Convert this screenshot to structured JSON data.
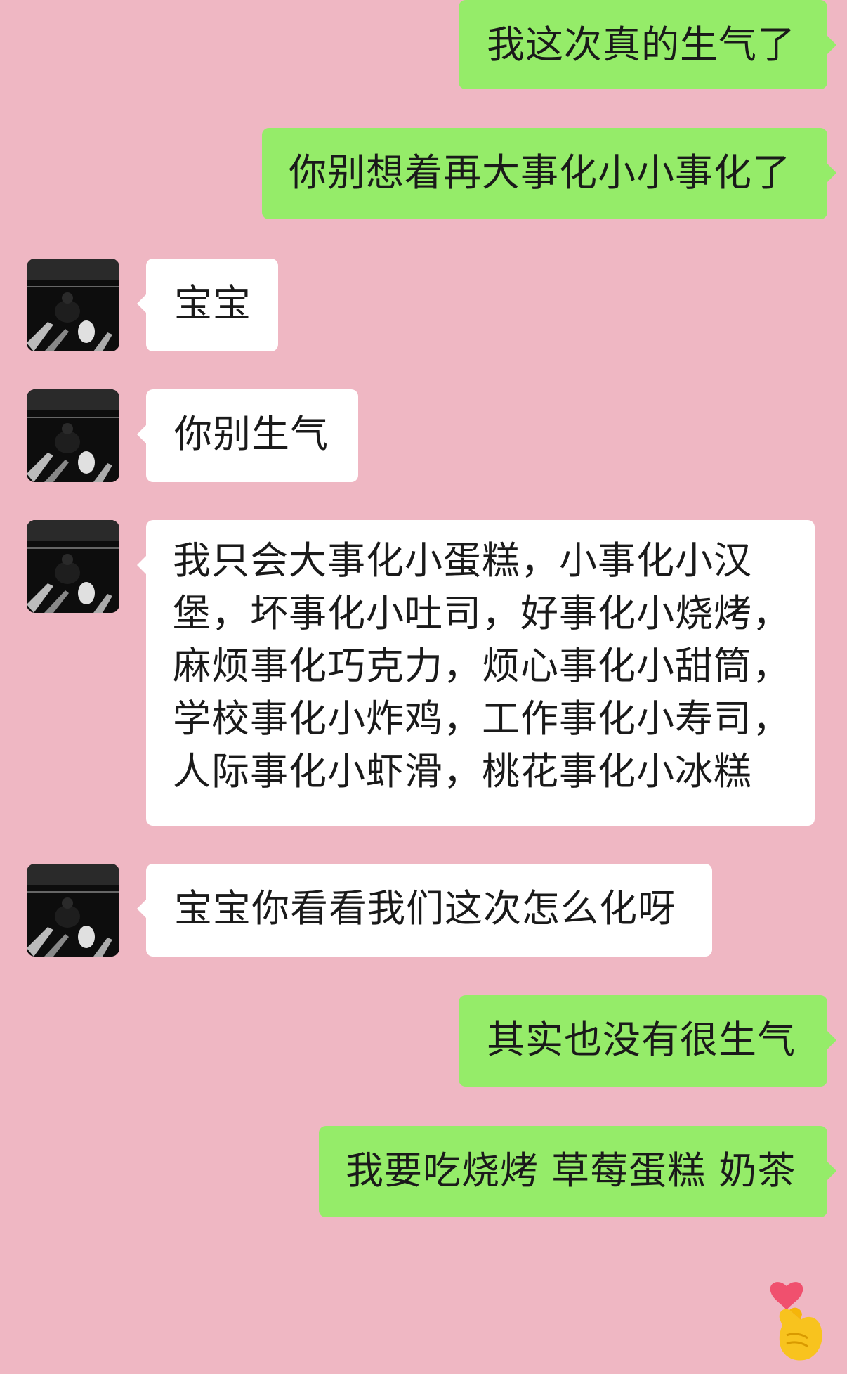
{
  "colors": {
    "background": "#efb7c3",
    "sent_bubble": "#95ec69",
    "received_bubble": "#ffffff",
    "text": "#1a1a1a"
  },
  "messages": [
    {
      "side": "right",
      "text": "我这次真的生气了"
    },
    {
      "side": "right",
      "text": "你别想着再大事化小小事化了"
    },
    {
      "side": "left",
      "text": "宝宝"
    },
    {
      "side": "left",
      "text": "你别生气"
    },
    {
      "side": "left",
      "lines": [
        "我只会大事化小蛋糕，小事化小汉",
        "堡，坏事化小吐司，好事化小烧烤，",
        "麻烦事化巧克力，烦心事化小甜筒，",
        "学校事化小炸鸡，工作事化小寿司，",
        "人际事化小虾滑，桃花事化小冰糕"
      ]
    },
    {
      "side": "left",
      "text": "宝宝你看看我们这次怎么化呀"
    },
    {
      "side": "right",
      "text": "其实也没有很生气"
    },
    {
      "side": "right",
      "text": "我要吃烧烤 草莓蛋糕 奶茶"
    }
  ],
  "sticker": {
    "icon": "finger-heart-emoji-icon"
  }
}
